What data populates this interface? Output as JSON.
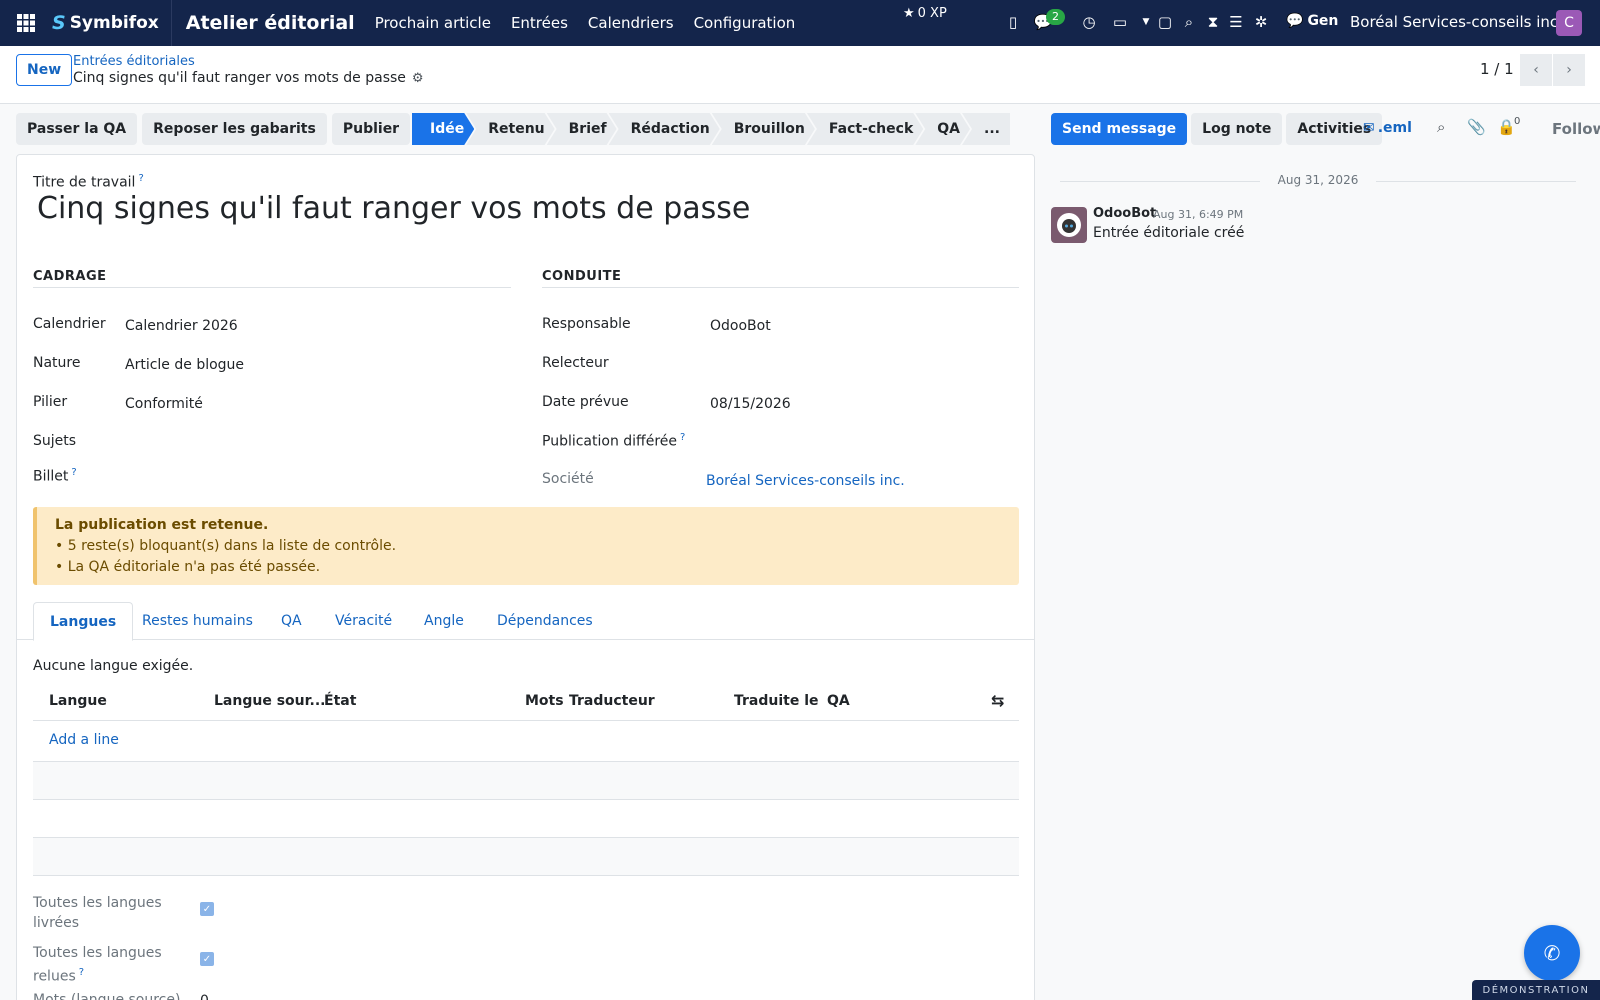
{
  "topbar": {
    "brand_logo": "S",
    "brand_name": "Symbifox",
    "app_title": "Atelier éditorial",
    "menu": [
      "Prochain article",
      "Entrées",
      "Calendriers",
      "Configuration"
    ],
    "xp": "0 XP",
    "chat_count": "2",
    "gen_label": "Gen",
    "company": "Boréal Services-conseils inc.",
    "avatar_letter": "C"
  },
  "control": {
    "new_label": "New",
    "breadcrumb_parent": "Entrées éditoriales",
    "breadcrumb_current": "Cinq signes qu'il faut ranger vos mots de passe",
    "pager": "1 / 1"
  },
  "actions": [
    "Passer la QA",
    "Reposer les gabarits",
    "Publier"
  ],
  "stages": [
    "Idée",
    "Retenu",
    "Brief",
    "Rédaction",
    "Brouillon",
    "Fact-check",
    "QA",
    "..."
  ],
  "active_stage": "Idée",
  "form": {
    "title_label": "Titre de travail",
    "title_help": "?",
    "title_value": "Cinq signes qu'il faut ranger vos mots de passe",
    "sec_left": "CADRAGE",
    "sec_right": "CONDUITE",
    "left_fields": [
      {
        "label": "Calendrier",
        "value": "Calendrier 2026"
      },
      {
        "label": "Nature",
        "value": "Article de blogue"
      },
      {
        "label": "Pilier",
        "value": "Conformité"
      },
      {
        "label": "Sujets",
        "value": ""
      },
      {
        "label": "Billet",
        "value": ""
      }
    ],
    "right_fields": [
      {
        "label": "Responsable",
        "value": "OdooBot"
      },
      {
        "label": "Relecteur",
        "value": ""
      },
      {
        "label": "Date prévue",
        "value": "08/15/2026"
      },
      {
        "label": "Publication différée",
        "value": ""
      },
      {
        "label": "Société",
        "value": "Boréal Services-conseils inc."
      }
    ],
    "alert_title": "La publication est retenue.",
    "alert_line1": "• 5 reste(s) bloquant(s) dans la liste de contrôle.",
    "alert_line2": "• La QA éditoriale n'a pas été passée."
  },
  "tabs": [
    "Langues",
    "Restes humains",
    "QA",
    "Véracité",
    "Angle",
    "Dépendances"
  ],
  "languages": {
    "empty_text": "Aucune langue exigée.",
    "columns": [
      "Langue",
      "Langue sour...",
      "État",
      "Mots",
      "Traducteur",
      "Traduite le",
      "QA"
    ],
    "add_line": "Add a line",
    "check1_label_a": "Toutes les langues",
    "check1_label_b": "livrées",
    "check2_label_a": "Toutes les langues",
    "check2_label_b": "relues",
    "check2_help": "?",
    "words_label": "Mots (langue source)",
    "words_value": "0"
  },
  "chatter": {
    "send": "Send message",
    "log": "Log note",
    "activities": "Activities",
    "eml": ".eml",
    "followers_count": "0",
    "follow": "Follow",
    "date": "Aug 31, 2026",
    "author": "OdooBot",
    "time": "Aug 31, 6:49 PM",
    "body": "Entrée éditoriale créé"
  },
  "demo_label": "DÉMONSTRATION"
}
